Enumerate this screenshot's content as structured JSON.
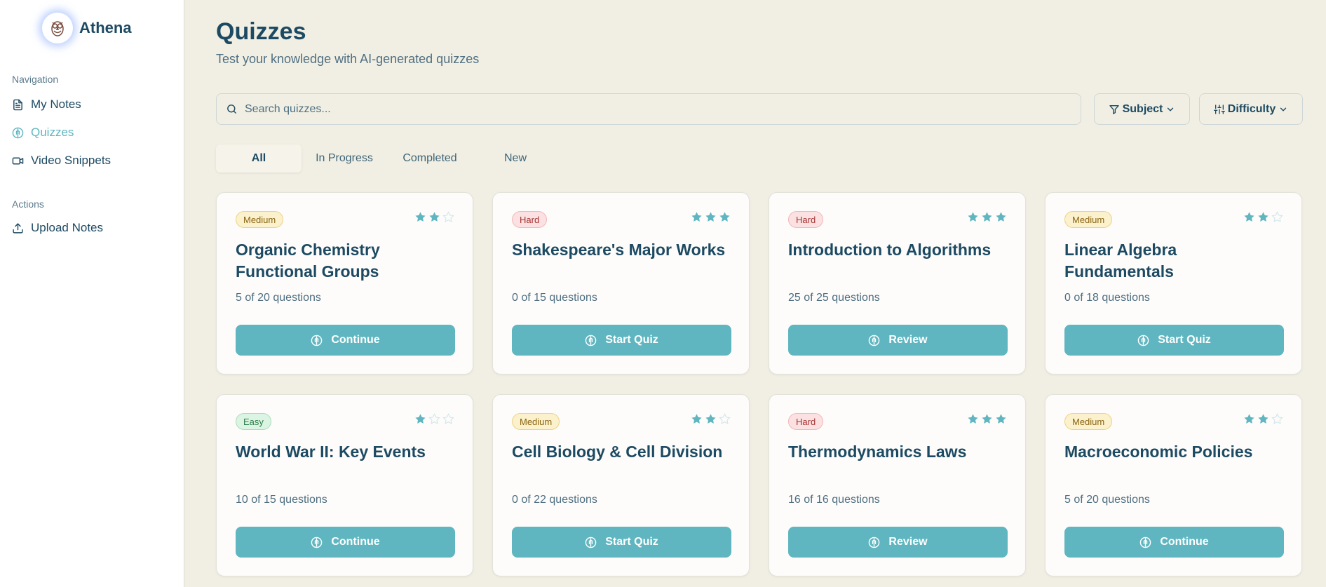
{
  "app": {
    "name": "Athena"
  },
  "sidebar": {
    "nav_label": "Navigation",
    "actions_label": "Actions",
    "items": [
      {
        "label": "My Notes",
        "icon": "document-icon",
        "active": false
      },
      {
        "label": "Quizzes",
        "icon": "brain-icon",
        "active": true
      },
      {
        "label": "Video Snippets",
        "icon": "video-icon",
        "active": false
      }
    ],
    "actions": [
      {
        "label": "Upload Notes",
        "icon": "upload-icon"
      }
    ]
  },
  "header": {
    "title": "Quizzes",
    "subtitle": "Test your knowledge with AI-generated quizzes"
  },
  "search": {
    "placeholder": "Search quizzes...",
    "value": ""
  },
  "filters": {
    "subject": "Subject",
    "difficulty": "Difficulty"
  },
  "tabs": [
    {
      "label": "All",
      "active": true
    },
    {
      "label": "In Progress",
      "active": false
    },
    {
      "label": "Completed",
      "active": false
    },
    {
      "label": "New",
      "active": false
    }
  ],
  "colors": {
    "accent": "#5fb6c0",
    "primary_text": "#1d4a63",
    "background": "#f1efe3"
  },
  "quizzes": [
    {
      "difficulty": "Medium",
      "stars": 2,
      "title": "Organic Chemistry Functional Groups",
      "progress": "5 of 20 questions",
      "action": "Continue"
    },
    {
      "difficulty": "Hard",
      "stars": 3,
      "title": "Shakespeare's Major Works",
      "progress": "0 of 15 questions",
      "action": "Start Quiz"
    },
    {
      "difficulty": "Hard",
      "stars": 3,
      "title": "Introduction to Algorithms",
      "progress": "25 of 25 questions",
      "action": "Review"
    },
    {
      "difficulty": "Medium",
      "stars": 2,
      "title": "Linear Algebra Fundamentals",
      "progress": "0 of 18 questions",
      "action": "Start Quiz"
    },
    {
      "difficulty": "Easy",
      "stars": 1,
      "title": "World War II: Key Events",
      "progress": "10 of 15 questions",
      "action": "Continue"
    },
    {
      "difficulty": "Medium",
      "stars": 2,
      "title": "Cell Biology & Cell Division",
      "progress": "0 of 22 questions",
      "action": "Start Quiz"
    },
    {
      "difficulty": "Hard",
      "stars": 3,
      "title": "Thermodynamics Laws",
      "progress": "16 of 16 questions",
      "action": "Review"
    },
    {
      "difficulty": "Medium",
      "stars": 2,
      "title": "Macroeconomic Policies",
      "progress": "5 of 20 questions",
      "action": "Continue"
    }
  ]
}
